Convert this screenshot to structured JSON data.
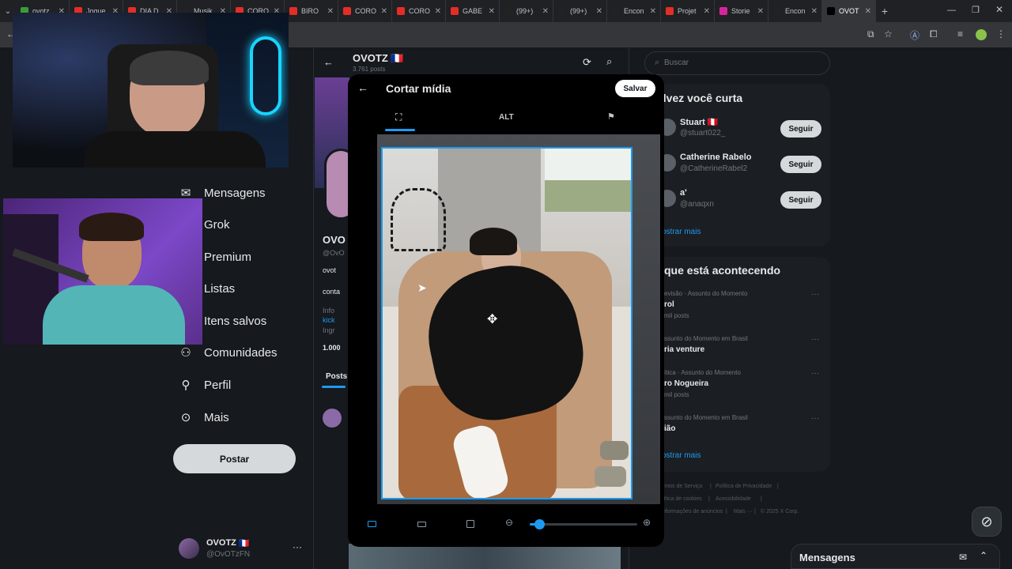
{
  "browser": {
    "tabs": [
      {
        "label": "ovotz",
        "color": "#3a9d3a"
      },
      {
        "label": "Jogue",
        "color": "#e52d27"
      },
      {
        "label": "DIA D",
        "color": "#e52d27"
      },
      {
        "label": "Musik",
        "color": "#222222"
      },
      {
        "label": "CORO",
        "color": "#e52d27"
      },
      {
        "label": "BIRO",
        "color": "#e52d27"
      },
      {
        "label": "CORO",
        "color": "#e52d27"
      },
      {
        "label": "CORO",
        "color": "#e52d27"
      },
      {
        "label": "GABE",
        "color": "#e52d27"
      },
      {
        "label": "(99+)",
        "color": "#222222"
      },
      {
        "label": "(99+)",
        "color": "#222222"
      },
      {
        "label": "Encon",
        "color": "#222222"
      },
      {
        "label": "Projet",
        "color": "#e52d27"
      },
      {
        "label": "Storie",
        "color": "#d6249f"
      },
      {
        "label": "Encon",
        "color": "#222222"
      },
      {
        "label": "OVOT",
        "color": "#000000"
      }
    ],
    "new_tab": "+"
  },
  "left_nav": {
    "items": [
      {
        "label": "Mensagens",
        "icon": "mail-icon"
      },
      {
        "label": "Grok",
        "icon": "grok-icon"
      },
      {
        "label": "Premium",
        "icon": "premium-icon"
      },
      {
        "label": "Listas",
        "icon": "list-icon"
      },
      {
        "label": "Itens salvos",
        "icon": "bookmark-icon"
      },
      {
        "label": "Comunidades",
        "icon": "community-icon"
      },
      {
        "label": "Perfil",
        "icon": "person-icon"
      },
      {
        "label": "Mais",
        "icon": "more-icon"
      }
    ],
    "post_button": "Postar",
    "account": {
      "name": "OVOTZ",
      "flag": "🇫🇷",
      "handle": "@OvOTzFN"
    }
  },
  "profile": {
    "name": "OVOTZ",
    "flag": "🇫🇷",
    "posts_count": "3.761 posts",
    "short_name": "OVO",
    "handle_partial": "@OvO",
    "bio_partial": "ovot",
    "contact_partial": "conta",
    "info1": "Info",
    "link": "kick",
    "joined": "Ingr",
    "followers": "1.000",
    "tab_posts": "Posts"
  },
  "modal": {
    "title": "Cortar mídia",
    "save_label": "Salvar",
    "tab_alt": "ALT",
    "zoom_value": 0.05
  },
  "right": {
    "search_placeholder": "Buscar",
    "suggest_title": "alvez você curta",
    "suggestions": [
      {
        "name": "Stuart 🇵🇪",
        "handle": "@stuart022_",
        "button": "Seguir"
      },
      {
        "name": "Catherine Rabelo",
        "handle": "@CatherineRabel2",
        "button": "Seguir"
      },
      {
        "name": "a'",
        "handle": "@anaqxn",
        "button": "Seguir"
      }
    ],
    "show_more": "ostrar mais",
    "trends_title": "que está acontecendo",
    "trends": [
      {
        "meta": "evisão · Assunto do Momento",
        "title": "rol",
        "count": "mil posts"
      },
      {
        "meta": "ssunto do Momento em Brasil",
        "title": "ria venture",
        "count": ""
      },
      {
        "meta": "ítica · Assunto do Momento",
        "title": "ro Nogueira",
        "count": "mil posts"
      },
      {
        "meta": "ssunto do Momento em Brasil",
        "title": "ião",
        "count": ""
      }
    ],
    "trends_more": "ostrar mais",
    "footer": [
      "rmos de Serviço",
      "|",
      "Política de Privacidade",
      "|",
      "lítica de cookies",
      "|",
      "Acessibilidade",
      "|",
      "nformações de anúncios",
      "|",
      "Mais ···",
      "|",
      "© 2025 X Corp."
    ],
    "messages_drawer": "Mensagens"
  },
  "colors": {
    "accent": "#1d9bf0",
    "bg": "#16191d",
    "card": "#1b1f24"
  }
}
